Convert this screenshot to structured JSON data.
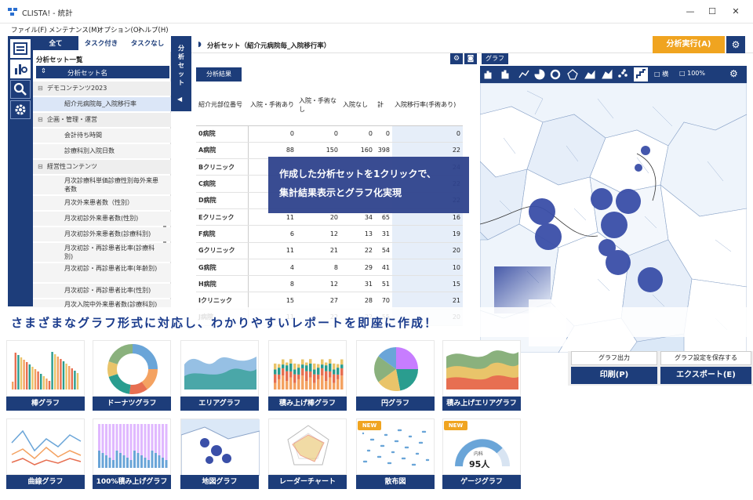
{
  "window": {
    "title": "CLISTA! - 統計"
  },
  "menu": [
    "ファイル(F)",
    "メンテナンス(M)",
    "オプション(O)",
    "ヘルプ(H)"
  ],
  "tabs": {
    "all": "全て",
    "with_task": "タスク付き",
    "no_task": "タスクなし"
  },
  "tree": {
    "header": "分析セット一覧",
    "col_header": "分析セット名",
    "rows": [
      {
        "label": "デモコンテンツ2023",
        "type": "grp"
      },
      {
        "label": "紹介元病院毎_入院移行率",
        "type": "sel"
      },
      {
        "label": "企画・管理・運営",
        "type": "grp"
      },
      {
        "label": "会計待ち時間",
        "type": "child"
      },
      {
        "label": "診療科別入院日数",
        "type": "child"
      },
      {
        "label": "経営性コンテンツ",
        "type": "grp"
      },
      {
        "label": "月次診療科単価診療性別毎外来患者数",
        "type": "child2"
      },
      {
        "label": "月次外来患者数（性別）",
        "type": "child"
      },
      {
        "label": "月次初診外来患者数(性別)",
        "type": "child"
      },
      {
        "label": "月次初診外来患者数(診療科別)",
        "type": "child"
      },
      {
        "label": "月次初診・再診患者比率(診療科別)",
        "type": "child2"
      },
      {
        "label": "月次初診・再診患者比率(年齢別)",
        "type": "child2"
      },
      {
        "label": "月次初診・再診患者比率(性別)",
        "type": "child"
      },
      {
        "label": "月次入院中外来患者数(診療科別)",
        "type": "child2"
      }
    ]
  },
  "collapse_label": "分析セット",
  "main": {
    "title": "分析セット（紹介元病院毎_入院移行率）",
    "run_button": "分析実行(A)",
    "result_tab": "分析結果",
    "graph_tab": "グラフ"
  },
  "table": {
    "headers": [
      "紹介元部位番号",
      "入院・手術あり",
      "入院・手術なし",
      "入院なし",
      "計",
      "入院移行率(手術あり)"
    ],
    "rows": [
      [
        "0病院",
        "0",
        "0",
        "0",
        "0",
        "0"
      ],
      [
        "A病院",
        "88",
        "150",
        "160",
        "398",
        "22"
      ],
      [
        "Bクリニック",
        "",
        "",
        "",
        "",
        "24"
      ],
      [
        "C病院",
        "",
        "",
        "",
        "",
        "22"
      ],
      [
        "D病院",
        "",
        "",
        "",
        "",
        "22"
      ],
      [
        "Eクリニック",
        "11",
        "20",
        "34",
        "65",
        "16"
      ],
      [
        "F病院",
        "6",
        "12",
        "13",
        "31",
        "19"
      ],
      [
        "Gクリニック",
        "11",
        "21",
        "22",
        "54",
        "20"
      ],
      [
        "G病院",
        "4",
        "8",
        "29",
        "41",
        "10"
      ],
      [
        "H病院",
        "8",
        "12",
        "31",
        "51",
        "15"
      ],
      [
        "Iクリニック",
        "15",
        "27",
        "28",
        "70",
        "21"
      ],
      [
        "J病院",
        "11",
        "22",
        "22",
        "55",
        "20"
      ]
    ]
  },
  "graph_toolbar": {
    "check1": "□ 横",
    "check2": "□ 100%"
  },
  "overlay": {
    "line1": "作成した分析セットを1クリックで、",
    "line2": "集計結果表示とグラフ化実現"
  },
  "banner": "さまざまなグラフ形式に対応し、わかりやすいレポートを即座に作成！",
  "graph_buttons": {
    "output": "グラフ出力",
    "save": "グラフ設定を保存する",
    "print": "印刷(P)",
    "export": "エクスポート(E)"
  },
  "cards": [
    {
      "label": "棒グラフ"
    },
    {
      "label": "ドーナツグラフ"
    },
    {
      "label": "エリアグラフ"
    },
    {
      "label": "積み上げ棒グラフ"
    },
    {
      "label": "円グラフ"
    },
    {
      "label": "積み上げエリアグラフ"
    },
    {
      "label": "曲線グラフ"
    },
    {
      "label": "100%積み上げグラフ"
    },
    {
      "label": "地図グラフ"
    },
    {
      "label": "レーダーチャート"
    },
    {
      "label": "散布図",
      "new": "NEW"
    },
    {
      "label": "ゲージグラフ",
      "new": "NEW",
      "value": "95人",
      "sub": "内科"
    }
  ],
  "colors": {
    "navy": "#1d3d7a",
    "orange": "#f0a420",
    "dot": "#3a4fa8"
  }
}
